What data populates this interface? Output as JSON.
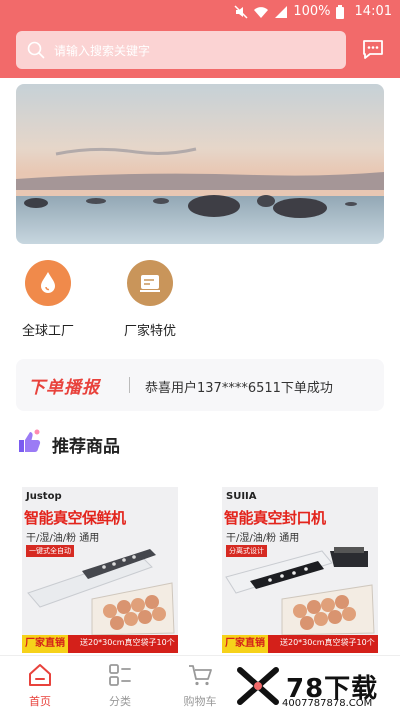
{
  "status_bar": {
    "battery": "100%",
    "time": "14:01"
  },
  "search": {
    "placeholder": "请输入搜索关键字"
  },
  "quick_entries": [
    {
      "label": "全球工厂",
      "icon": "drop-icon",
      "color": "#f08a4b"
    },
    {
      "label": "厂家特优",
      "icon": "card-icon",
      "color": "#c9955a"
    }
  ],
  "broadcast": {
    "tag": "下单播报",
    "message": "恭喜用户137****6511下单成功"
  },
  "recommend": {
    "title": "推荐商品"
  },
  "products": [
    {
      "brand": "Justop",
      "title": "智能真空保鲜机",
      "subtitle": "干/湿/油/粉 通用",
      "badge": "一键式全自动",
      "strip_tag": "厂家直销",
      "strip_text": "送20*30cm真空袋子10个"
    },
    {
      "brand": "SUIIA",
      "title": "智能真空封口机",
      "subtitle": "干/湿/油/粉 通用",
      "badge": "分离式设计",
      "strip_tag": "厂家直销",
      "strip_text": "送20*30cm真空袋子10个"
    }
  ],
  "nav": [
    {
      "label": "首页",
      "icon": "home-icon",
      "active": true
    },
    {
      "label": "分类",
      "icon": "category-icon",
      "active": false
    },
    {
      "label": "购物车",
      "icon": "cart-icon",
      "active": false
    }
  ],
  "watermark": {
    "name": "78下载",
    "site": "4007787878.COM"
  },
  "colors": {
    "header": "#f26a6a",
    "accent": "#e8423c",
    "nav_active": "#e8423c",
    "nav_inactive": "#999999"
  }
}
